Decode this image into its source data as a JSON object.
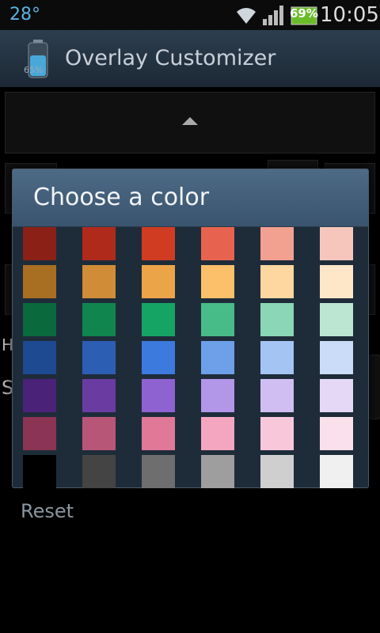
{
  "status_bar": {
    "temperature": "28°",
    "battery_level": "69%",
    "time": "10:05"
  },
  "action_bar": {
    "app_icon_percent": "65%",
    "title": "Overlay Customizer"
  },
  "background": {
    "partial_label_h": "H",
    "partial_label_s": "S",
    "reset_label": "Reset"
  },
  "dialog": {
    "title": "Choose a color",
    "colors": [
      [
        "#8a2016",
        "#b02a1c",
        "#d03c22",
        "#e8634f",
        "#f2a090",
        "#f6c6bc"
      ],
      [
        "#a86e22",
        "#d08c36",
        "#eca448",
        "#fcbf6a",
        "#fdd6a0",
        "#fee6c8"
      ],
      [
        "#0a6a3e",
        "#10864e",
        "#16a464",
        "#48bc88",
        "#8ad6b6",
        "#bce6d2"
      ],
      [
        "#1e4a92",
        "#2c5eb4",
        "#3c7ade",
        "#6ea0ea",
        "#a4c4f4",
        "#cadcf8"
      ],
      [
        "#4a2278",
        "#6a3ca2",
        "#8e62d0",
        "#b296e8",
        "#d0bef2",
        "#e4d8f6"
      ],
      [
        "#8c3454",
        "#b85678",
        "#e07898",
        "#f4a6c0",
        "#f8c8da",
        "#fae0ea"
      ],
      [
        "#000000",
        "#444444",
        "#6e6e6e",
        "#9e9e9e",
        "#cfcfcf",
        "#f0f0f0"
      ]
    ]
  }
}
